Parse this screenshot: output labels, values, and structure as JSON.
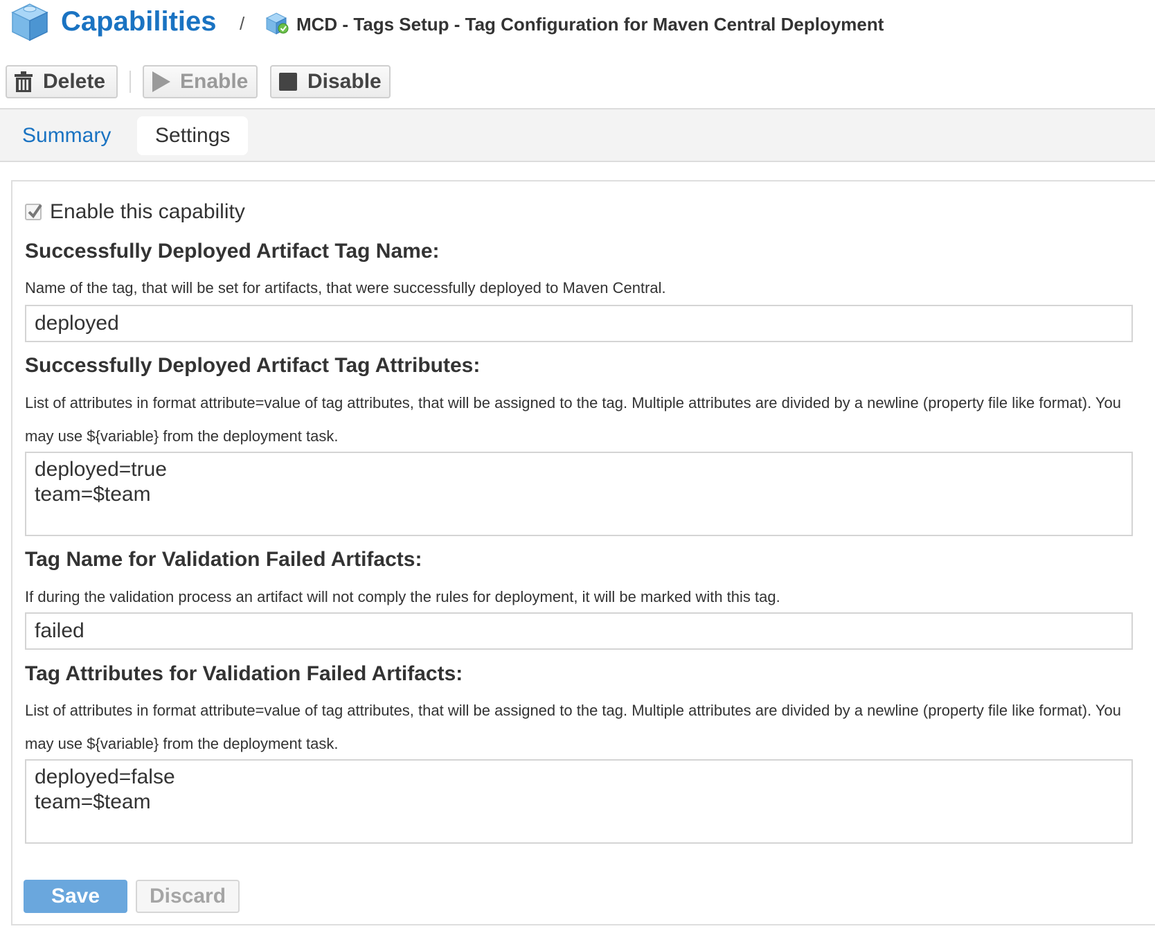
{
  "header": {
    "title": "Capabilities",
    "separator": "/",
    "breadcrumb_label": "MCD - Tags Setup - Tag Configuration for Maven Central Deployment",
    "title_icon": "capability-cube-icon",
    "breadcrumb_icon": "capability-enabled-cube-icon"
  },
  "toolbar": {
    "delete_label": "Delete",
    "enable_label": "Enable",
    "disable_label": "Disable",
    "delete_icon": "trash-icon",
    "enable_icon": "play-icon",
    "disable_icon": "stop-icon"
  },
  "tabs": [
    {
      "label": "Summary",
      "active": false
    },
    {
      "label": "Settings",
      "active": true
    }
  ],
  "form": {
    "enable_checkbox": {
      "label": "Enable this capability",
      "checked": true
    },
    "fields": [
      {
        "title": "Successfully Deployed Artifact Tag Name:",
        "description": "Name of the tag, that will be set for artifacts, that were successfully deployed to Maven Central.",
        "value": "deployed"
      },
      {
        "title": "Successfully Deployed Artifact Tag Attributes:",
        "description": "List of attributes in format attribute=value of tag attributes, that will be assigned to the tag. Multiple attributes are divided by a newline (property file like format). You may use ${variable} from the deployment task.",
        "value": "deployed=true\nteam=$team"
      },
      {
        "title": "Tag Name for Validation Failed Artifacts:",
        "description": "If during the validation process an artifact will not comply the rules for deployment, it will be marked with this tag.",
        "value": "failed"
      },
      {
        "title": "Tag Attributes for Validation Failed Artifacts:",
        "description": "List of attributes in format attribute=value of tag attributes, that will be assigned to the tag. Multiple attributes are divided by a newline (property file like format). You may use ${variable} from the deployment task.",
        "value": "deployed=false\nteam=$team"
      }
    ],
    "save_label": "Save",
    "discard_label": "Discard"
  },
  "colors": {
    "accent": "#1a73c2",
    "save_button": "#6aa7dd",
    "tabbar_bg": "#f3f3f3"
  }
}
